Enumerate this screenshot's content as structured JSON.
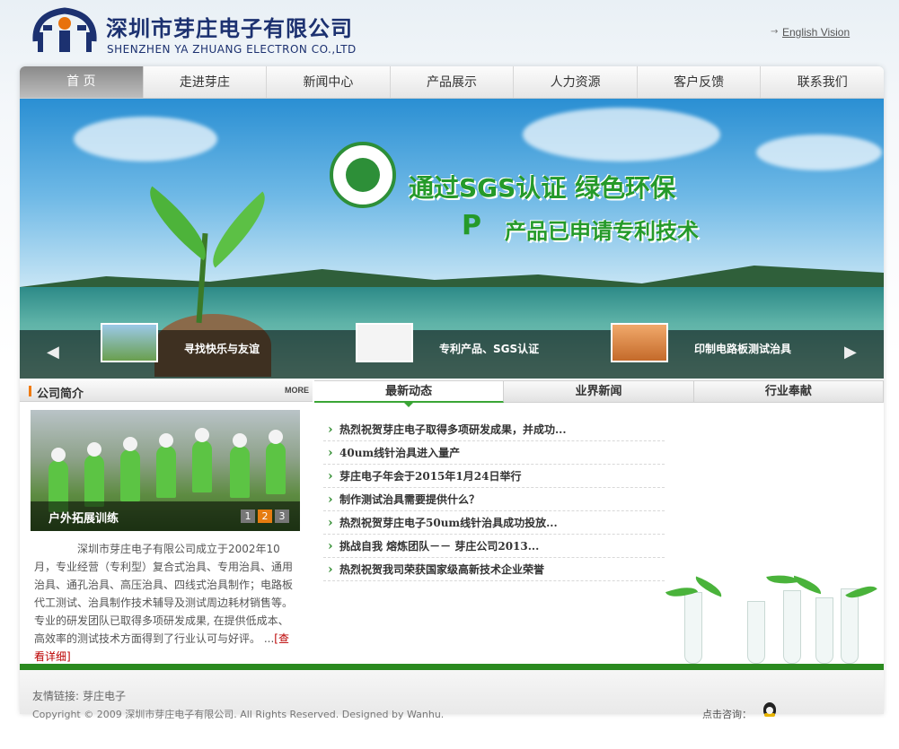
{
  "header": {
    "company_cn": "深圳市芽庄电子有限公司",
    "company_en": "SHENZHEN YA ZHUANG ELECTRON CO.,LTD",
    "language_link": "English Vision"
  },
  "nav": {
    "items": [
      "首 页",
      "走进芽庄",
      "新闻中心",
      "产品展示",
      "人力资源",
      "客户反馈",
      "联系我们"
    ]
  },
  "banner": {
    "slogan_line1": "通过SGS认证 绿色环保",
    "slogan_line2": "产品已申请专利技术",
    "thumbs": [
      {
        "caption": "寻找快乐与友谊"
      },
      {
        "caption": "专利产品、SGS认证"
      },
      {
        "caption": "印制电路板测试治具"
      }
    ]
  },
  "company_intro": {
    "heading": "公司简介",
    "more": "MORE",
    "photo_caption": "户外拓展训练",
    "pager": [
      "1",
      "2",
      "3"
    ],
    "active_page": "2",
    "text": "深圳市芽庄电子有限公司成立于2002年10月，专业经营（专利型）复合式治具、专用治具、通用治具、通孔治具、高压治具、四线式治具制作；电路板代工测试、治具制作技术辅导及测试周边耗材销售等。专业的研发团队已取得多项研发成果, 在提供低成本、高效率的测试技术方面得到了行业认可与好评。   ...",
    "more_link": "[查看详细]"
  },
  "news": {
    "tabs": [
      "最新动态",
      "业界新闻",
      "行业奉献"
    ],
    "active_tab": "最新动态",
    "items": [
      "热烈祝贺芽庄电子取得多项研发成果，并成功...",
      "40um线针治具进入量产",
      "芽庄电子年会于2015年1月24日举行",
      "制作测试治具需要提供什么？",
      "热烈祝贺芽庄电子50um线针治具成功投放...",
      "挑战自我 熔炼团队－－ 芽庄公司2013...",
      "热烈祝贺我司荣获国家级高新技术企业荣誉"
    ]
  },
  "footer": {
    "friend_label": "友情链接:",
    "friend_link": "芽庄电子",
    "copyright": "Copyright © 2009 深圳市芽庄电子有限公司. All Rights Reserved. Designed by Wanhu.",
    "consult": "点击咨询："
  },
  "colors": {
    "brand_blue": "#1c3170",
    "accent_green": "#2b8a1f",
    "accent_orange": "#e67c10"
  }
}
